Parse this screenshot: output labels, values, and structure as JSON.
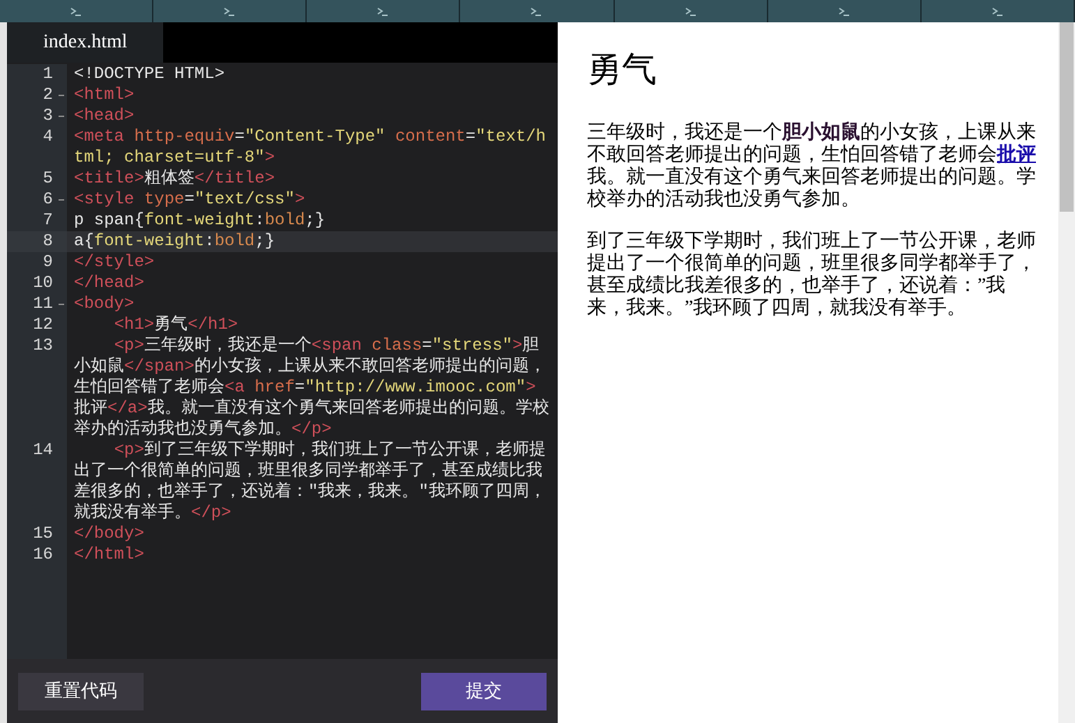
{
  "editor": {
    "tab": "index.html",
    "lines": [
      {
        "number": "1",
        "fold": false,
        "active": false,
        "tokens": [
          {
            "kind": "text",
            "text": "<!DOCTYPE HTML>"
          }
        ]
      },
      {
        "number": "2",
        "fold": true,
        "active": false,
        "tokens": [
          {
            "kind": "tag",
            "text": "<html>"
          }
        ]
      },
      {
        "number": "3",
        "fold": true,
        "active": false,
        "tokens": [
          {
            "kind": "tag",
            "text": "<head>"
          }
        ]
      },
      {
        "number": "4",
        "fold": false,
        "active": false,
        "tokens": [
          {
            "kind": "tag",
            "text": "<meta "
          },
          {
            "kind": "attr",
            "text": "http-equiv"
          },
          {
            "kind": "text",
            "text": "="
          },
          {
            "kind": "string",
            "text": "\"Content-Type\" "
          },
          {
            "kind": "attr",
            "text": "content"
          },
          {
            "kind": "text",
            "text": "="
          },
          {
            "kind": "string",
            "text": "\"text/html; charset=utf-8\""
          },
          {
            "kind": "tag",
            "text": ">"
          }
        ]
      },
      {
        "number": "5",
        "fold": false,
        "active": false,
        "tokens": [
          {
            "kind": "tag",
            "text": "<title>"
          },
          {
            "kind": "text",
            "text": "粗体签"
          },
          {
            "kind": "tag",
            "text": "</title>"
          }
        ]
      },
      {
        "number": "6",
        "fold": true,
        "active": false,
        "tokens": [
          {
            "kind": "tag",
            "text": "<style "
          },
          {
            "kind": "attr",
            "text": "type"
          },
          {
            "kind": "text",
            "text": "="
          },
          {
            "kind": "string",
            "text": "\"text/css\""
          },
          {
            "kind": "tag",
            "text": ">"
          }
        ]
      },
      {
        "number": "7",
        "fold": false,
        "active": false,
        "tokens": [
          {
            "kind": "text",
            "text": "p span{"
          },
          {
            "kind": "prop",
            "text": "font-weight"
          },
          {
            "kind": "text",
            "text": ":"
          },
          {
            "kind": "keyword",
            "text": "bold"
          },
          {
            "kind": "text",
            "text": ";}"
          }
        ]
      },
      {
        "number": "8",
        "fold": false,
        "active": true,
        "tokens": [
          {
            "kind": "text",
            "text": "a{"
          },
          {
            "kind": "prop",
            "text": "font-weight"
          },
          {
            "kind": "text",
            "text": ":"
          },
          {
            "kind": "keyword",
            "text": "bold"
          },
          {
            "kind": "text",
            "text": ";}"
          }
        ]
      },
      {
        "number": "9",
        "fold": false,
        "active": false,
        "tokens": [
          {
            "kind": "tag",
            "text": "</style>"
          }
        ]
      },
      {
        "number": "10",
        "fold": false,
        "active": false,
        "tokens": [
          {
            "kind": "tag",
            "text": "</head>"
          }
        ]
      },
      {
        "number": "11",
        "fold": true,
        "active": false,
        "tokens": [
          {
            "kind": "tag",
            "text": "<body>"
          }
        ]
      },
      {
        "number": "12",
        "fold": false,
        "active": false,
        "tokens": [
          {
            "kind": "tag",
            "text": "    <h1>"
          },
          {
            "kind": "text",
            "text": "勇气"
          },
          {
            "kind": "tag",
            "text": "</h1>"
          }
        ]
      },
      {
        "number": "13",
        "fold": false,
        "active": false,
        "tokens": [
          {
            "kind": "tag",
            "text": "    <p>"
          },
          {
            "kind": "text",
            "text": "三年级时，我还是一个"
          },
          {
            "kind": "tag",
            "text": "<span "
          },
          {
            "kind": "attr",
            "text": "class"
          },
          {
            "kind": "text",
            "text": "="
          },
          {
            "kind": "string",
            "text": "\"stress\""
          },
          {
            "kind": "tag",
            "text": ">"
          },
          {
            "kind": "text",
            "text": "胆小如鼠"
          },
          {
            "kind": "tag",
            "text": "</span>"
          },
          {
            "kind": "text",
            "text": "的小女孩，上课从来不敢回答老师提出的问题，生怕回答错了老师会"
          },
          {
            "kind": "tag",
            "text": "<a "
          },
          {
            "kind": "attr",
            "text": "href"
          },
          {
            "kind": "text",
            "text": "="
          },
          {
            "kind": "string",
            "text": "\"http://www.imooc.com\""
          },
          {
            "kind": "tag",
            "text": ">"
          },
          {
            "kind": "text",
            "text": "批评"
          },
          {
            "kind": "tag",
            "text": "</a>"
          },
          {
            "kind": "text",
            "text": "我。就一直没有这个勇气来回答老师提出的问题。学校举办的活动我也没勇气参加。"
          },
          {
            "kind": "tag",
            "text": "</p>"
          }
        ]
      },
      {
        "number": "14",
        "fold": false,
        "active": false,
        "tokens": [
          {
            "kind": "tag",
            "text": "    <p>"
          },
          {
            "kind": "text",
            "text": "到了三年级下学期时，我们班上了一节公开课，老师提出了一个很简单的问题，班里很多同学都举手了，甚至成绩比我差很多的，也举手了，还说着：\"我来，我来。\"我环顾了四周，就我没有举手。"
          },
          {
            "kind": "tag",
            "text": "</p>"
          }
        ]
      },
      {
        "number": "15",
        "fold": false,
        "active": false,
        "tokens": [
          {
            "kind": "tag",
            "text": "</body>"
          }
        ]
      },
      {
        "number": "16",
        "fold": false,
        "active": false,
        "tokens": [
          {
            "kind": "tag",
            "text": "</html>"
          }
        ]
      }
    ]
  },
  "buttons": {
    "reset": "重置代码",
    "submit": "提交"
  },
  "preview": {
    "heading": "勇气",
    "paragraphs": [
      [
        {
          "kind": "text",
          "text": "三年级时，我还是一个"
        },
        {
          "kind": "bold",
          "text": "胆小如鼠"
        },
        {
          "kind": "text",
          "text": "的小女孩，上课从来不敢回答老师提出的问题，生怕回答错了老师会"
        },
        {
          "kind": "link",
          "text": "批评"
        },
        {
          "kind": "text",
          "text": "我。就一直没有这个勇气来回答老师提出的问题。学校举办的活动我也没勇气参加。"
        }
      ],
      [
        {
          "kind": "text",
          "text": "到了三年级下学期时，我们班上了一节公开课，老师提出了一个很简单的问题，班里很多同学都举手了，甚至成绩比我差很多的，也举手了，还说着：”我来，我来。”我环顾了四周，就我没有举手。"
        }
      ]
    ]
  }
}
